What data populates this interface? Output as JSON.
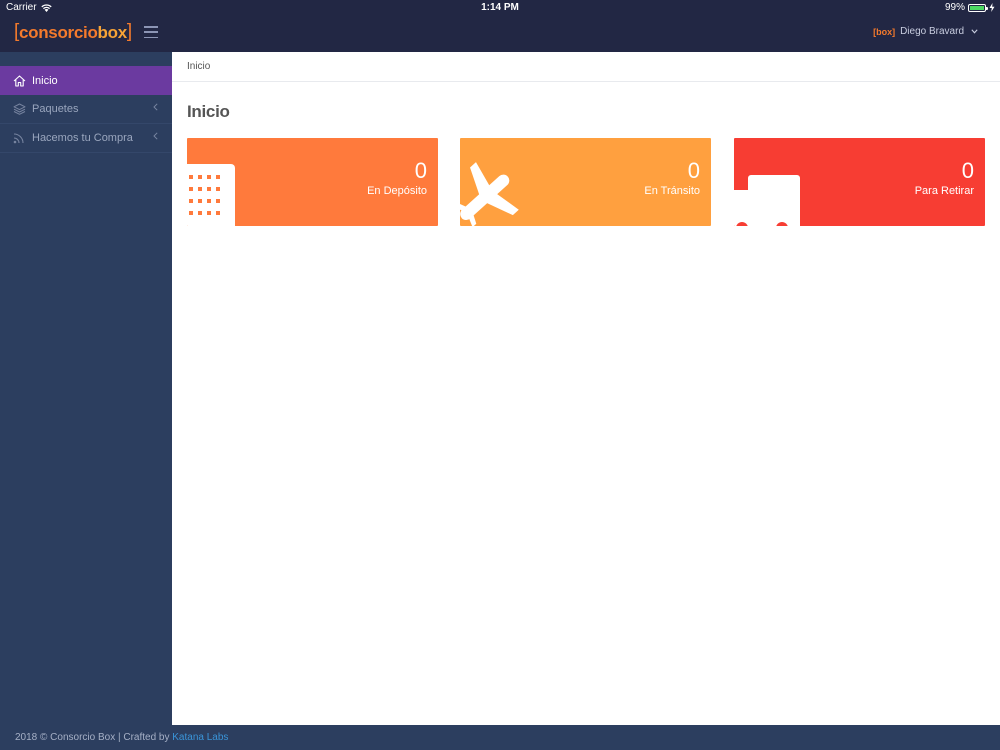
{
  "status_bar": {
    "carrier": "Carrier",
    "time": "1:14 PM",
    "battery": "99%"
  },
  "header": {
    "logo_prefix": "consorcio",
    "logo_suffix": "box",
    "user_logo": "[box]",
    "user_name": "Diego Bravard"
  },
  "sidebar": {
    "items": [
      {
        "label": "Inicio",
        "icon": "home-icon",
        "active": true
      },
      {
        "label": "Paquetes",
        "icon": "layers-icon",
        "active": false
      },
      {
        "label": "Hacemos tu Compra",
        "icon": "rss-icon",
        "active": false
      }
    ]
  },
  "breadcrumb": "Inicio",
  "page_title": "Inicio",
  "cards": [
    {
      "value": "0",
      "label": "En Depósito",
      "color": "#ff7a3c",
      "icon": "building-icon"
    },
    {
      "value": "0",
      "label": "En Tránsito",
      "color": "#ffa03f",
      "icon": "plane-icon"
    },
    {
      "value": "0",
      "label": "Para Retirar",
      "color": "#f73d33",
      "icon": "truck-icon"
    }
  ],
  "footer": {
    "text": "2018 © Consorcio Box | Crafted by ",
    "link": "Katana Labs"
  },
  "colors": {
    "navbar": "#222744",
    "sidebar": "#2c3e5f",
    "active": "#6b3aa0",
    "accent": "#f47a2c"
  }
}
